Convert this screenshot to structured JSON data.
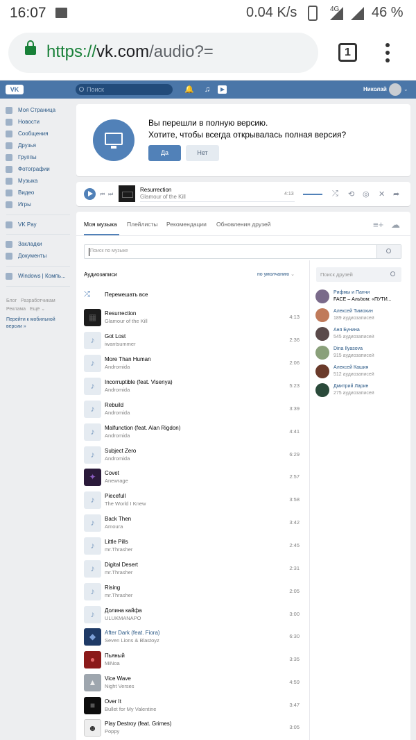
{
  "status_bar": {
    "time": "16:07",
    "speed": "0.04 K/s",
    "network": "4G",
    "battery": "46 %"
  },
  "browser": {
    "url_scheme": "https://",
    "url_host": "vk.com",
    "url_path": "/audio?=",
    "tab_count": "1"
  },
  "header": {
    "logo": "VK",
    "search_placeholder": "Поиск",
    "user_name": "Николай"
  },
  "sidebar": {
    "items": [
      {
        "label": "Моя Страница",
        "icon": "home-icon"
      },
      {
        "label": "Новости",
        "icon": "news-icon"
      },
      {
        "label": "Сообщения",
        "icon": "messages-icon"
      },
      {
        "label": "Друзья",
        "icon": "friends-icon"
      },
      {
        "label": "Группы",
        "icon": "groups-icon"
      },
      {
        "label": "Фотографии",
        "icon": "camera-icon"
      },
      {
        "label": "Музыка",
        "icon": "music-icon"
      },
      {
        "label": "Видео",
        "icon": "video-icon"
      },
      {
        "label": "Игры",
        "icon": "games-icon"
      }
    ],
    "items2": [
      {
        "label": "VK Pay",
        "icon": "vkpay-icon"
      }
    ],
    "items3": [
      {
        "label": "Закладки",
        "icon": "star-icon"
      },
      {
        "label": "Документы",
        "icon": "document-icon"
      }
    ],
    "items4": [
      {
        "label": "Windows | Компь...",
        "icon": "group-icon"
      }
    ],
    "footer_blog": "Блог",
    "footer_dev": "Разработчикам",
    "footer_ads": "Реклама",
    "footer_more": "Ещё",
    "mobile_link": "Перейти к мобильной версии »"
  },
  "banner": {
    "line1": "Вы перешли в полную версию.",
    "line2": "Хотите, чтобы всегда открывалась полная версия?",
    "yes": "Да",
    "no": "Нет"
  },
  "player": {
    "title": "Resurrection",
    "artist": "Glamour of the Kill",
    "time": "4:13"
  },
  "tabs": [
    "Моя музыка",
    "Плейлисты",
    "Рекомендации",
    "Обновления друзей"
  ],
  "music_search_placeholder": "Поиск по музыке",
  "audio_heading": "Аудиозаписи",
  "sort_label": "по умолчанию",
  "shuffle_label": "Перемешать все",
  "tracks": [
    {
      "title": "Resurrection",
      "artist": "Glamour of the Kill",
      "duration": "4:13"
    },
    {
      "title": "Got Lost",
      "artist": "iwantsummer",
      "duration": "2:36"
    },
    {
      "title": "More Than Human",
      "artist": "Andromida",
      "duration": "2:06"
    },
    {
      "title": "Incorruptible (feat. Visenya)",
      "artist": "Andromida",
      "duration": "5:23"
    },
    {
      "title": "Rebuild",
      "artist": "Andromida",
      "duration": "3:39"
    },
    {
      "title": "Malfunction (feat. Alan Rigdon)",
      "artist": "Andromida",
      "duration": "4:41"
    },
    {
      "title": "Subject Zero",
      "artist": "Andromida",
      "duration": "6:29"
    },
    {
      "title": "Covet",
      "artist": "Anewrage",
      "duration": "2:57"
    },
    {
      "title": "Piecefull",
      "artist": "The World I Knew",
      "duration": "3:58"
    },
    {
      "title": "Back Then",
      "artist": "Amoura",
      "duration": "3:42"
    },
    {
      "title": "Little Pills",
      "artist": "mr.Thrasher",
      "duration": "2:45"
    },
    {
      "title": "Digital Desert",
      "artist": "mr.Thrasher",
      "duration": "2:31"
    },
    {
      "title": "Rising",
      "artist": "mr.Thrasher",
      "duration": "2:05"
    },
    {
      "title": "Долина кайфа",
      "artist": "ULUKMANAPO",
      "duration": "3:00"
    },
    {
      "title": "After Dark (feat. Fiora)",
      "artist": "Seven Lions & Blastoyz",
      "duration": "6:30"
    },
    {
      "title": "Пьяный",
      "artist": "MiNoa",
      "duration": "3:35"
    },
    {
      "title": "Vice Wave",
      "artist": "Night Verses",
      "duration": "4:59"
    },
    {
      "title": "Over It",
      "artist": "Bullet for My Valentine",
      "duration": "3:47"
    },
    {
      "title": "Play Destroy (feat. Grimes)",
      "artist": "Poppy",
      "duration": "3:05"
    }
  ],
  "friends_search_placeholder": "Поиск друзей",
  "friends": [
    {
      "name": "Рифмы и Панчи",
      "sub": "FACE – Альбом: «ПУТИ..."
    },
    {
      "name": "Алексей Тимохин",
      "sub": "189 аудиозаписей"
    },
    {
      "name": "Аня Бунина",
      "sub": "545 аудиозаписей"
    },
    {
      "name": "Dina Ilyasova",
      "sub": "915 аудиозаписей"
    },
    {
      "name": "Алексей Кашия",
      "sub": "512 аудиозаписей"
    },
    {
      "name": "Дмитрий Ларин",
      "sub": "275 аудиозаписей"
    }
  ]
}
